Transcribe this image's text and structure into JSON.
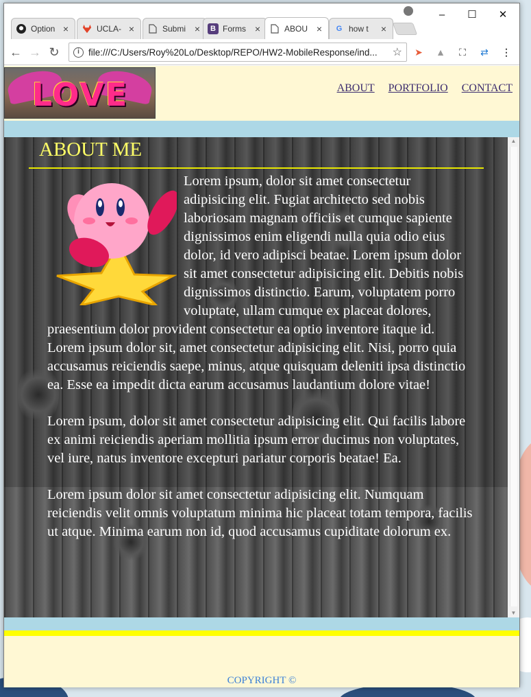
{
  "browser": {
    "tabs": [
      {
        "title": "Option",
        "icon": "github-icon"
      },
      {
        "title": "UCLA-",
        "icon": "gitlab-icon"
      },
      {
        "title": "Submi",
        "icon": "document-icon"
      },
      {
        "title": "Forms",
        "icon": "bootstrap-icon"
      },
      {
        "title": "ABOU",
        "icon": "document-icon"
      },
      {
        "title": "how t",
        "icon": "google-icon"
      }
    ],
    "url": "file:///C:/Users/Roy%20Lo/Desktop/REPO/HW2-MobileResponse/ind..."
  },
  "site": {
    "logo_text": "LOVE",
    "nav": [
      "ABOUT",
      "PORTFOLIO",
      "CONTACT"
    ],
    "section_title": "ABOUT ME",
    "paragraphs": [
      "Lorem ipsum, dolor sit amet consectetur adipisicing elit. Fugiat architecto sed nobis laboriosam magnam officiis et cumque sapiente dignissimos enim eligendi nulla quia odio eius dolor, id vero adipisci beatae. Lorem ipsum dolor sit amet consectetur adipisicing elit. Debitis nobis dignissimos distinctio. Earum, voluptatem porro voluptate, ullam cumque ex placeat dolores, praesentium dolor provident consectetur ea optio inventore itaque id. Lorem ipsum dolor sit, amet consectetur adipisicing elit. Nisi, porro quia accusamus reiciendis saepe, minus, atque quisquam deleniti ipsa distinctio ea. Esse ea impedit dicta earum accusamus laudantium dolore vitae!",
      "Lorem ipsum, dolor sit amet consectetur adipisicing elit. Qui facilis labore ex animi reiciendis aperiam mollitia ipsum error ducimus non voluptates, vel iure, natus inventore excepturi pariatur corporis beatae! Ea.",
      "Lorem ipsum dolor sit amet consectetur adipisicing elit. Numquam reiciendis velit omnis voluptatum minima hic placeat totam tempora, facilis ut atque. Minima earum non id, quod accusamus cupiditate dolorum ex."
    ],
    "copyright": "COPYRIGHT ©"
  }
}
